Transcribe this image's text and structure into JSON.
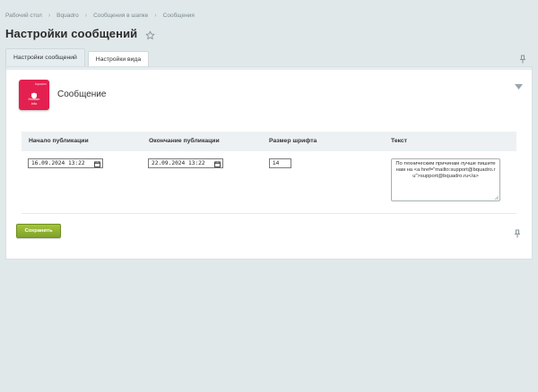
{
  "breadcrumbs": [
    "Рабочий стол",
    "Bquadro",
    "Сообщения в шапке",
    "Сообщения"
  ],
  "page_title": "Настройки сообщений",
  "tabs": [
    {
      "label": "Настройки сообщений",
      "active": true
    },
    {
      "label": "Настройки вида",
      "active": false
    }
  ],
  "module": {
    "title": "Сообщение",
    "icon_top_label": "bquadro",
    "icon_line1": "Header",
    "icon_line2": "info",
    "icon_color": "#e3204f"
  },
  "table": {
    "headers": [
      "Начало публикации",
      "Окончание публикации",
      "Размер шрифта",
      "Текст"
    ],
    "row": {
      "start": "16.09.2024 13:22",
      "end": "22.09.2024 13:22",
      "font_size": "14",
      "text": "По техническим причинам лучше пишите нам на <a href=\"mailto:support@bquadro.ru\">support@bquadro.ru</a>"
    }
  },
  "save_button": "Сохранить",
  "colors": {
    "background": "#e1e8ea",
    "save_green": "#8db131"
  }
}
